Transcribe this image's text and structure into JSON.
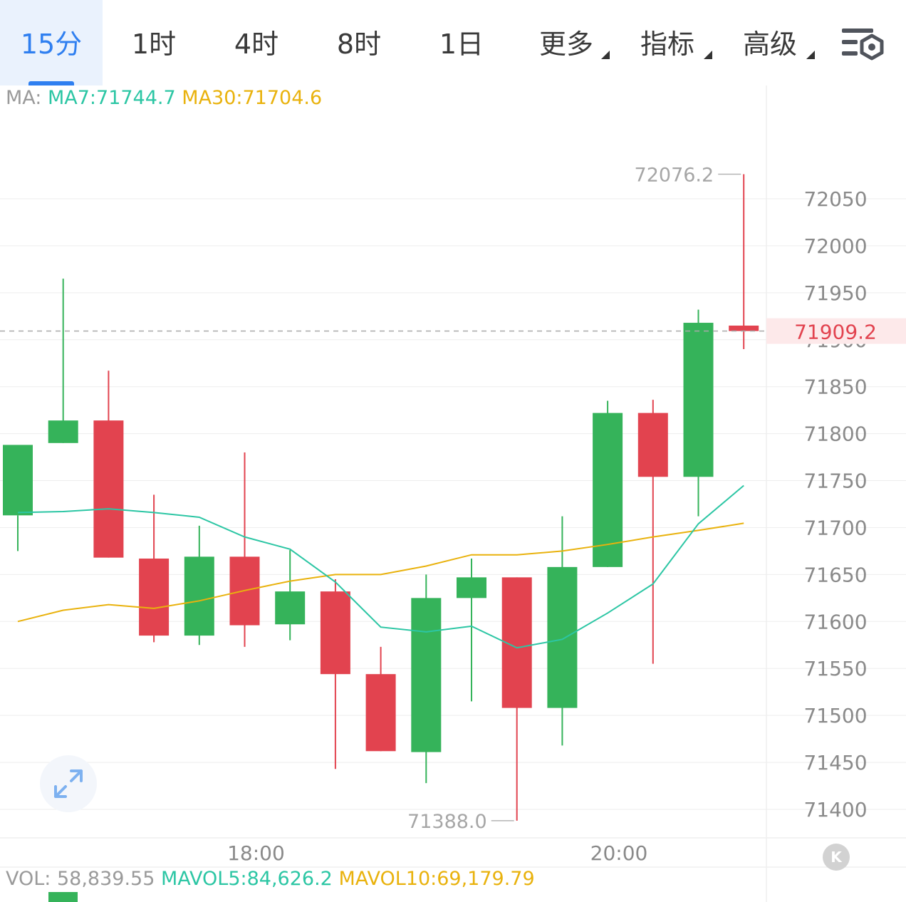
{
  "tabs": [
    {
      "label": "15分",
      "active": true
    },
    {
      "label": "1时"
    },
    {
      "label": "4时"
    },
    {
      "label": "8时"
    },
    {
      "label": "1日"
    },
    {
      "label": "更多",
      "dropdown": true
    },
    {
      "label": "指标",
      "dropdown": true
    },
    {
      "label": "高级",
      "dropdown": true
    }
  ],
  "settings_icon": "chart-settings-icon",
  "ma": {
    "prefix": "MA:",
    "ma7": "MA7:71744.7",
    "ma30": "MA30:71704.6"
  },
  "vol": {
    "prefix": "VOL:",
    "value": "58,839.55",
    "mavol5": "MAVOL5:84,626.2",
    "mavol10": "MAVOL10:69,179.79"
  },
  "expand_icon": "expand-arrows-icon",
  "kline_button": {
    "icon": "k-icon",
    "label": "K"
  },
  "colors": {
    "up": "#35b35a",
    "down": "#e2434f",
    "ma7": "#2cc6a4",
    "ma30": "#e9b20d",
    "accent": "#2f7ff0",
    "grid": "#eeeeee",
    "axis_text": "#8a8a8a"
  },
  "chart_data": {
    "type": "candlestick",
    "ylim": [
      71360,
      72110
    ],
    "y_ticks": [
      72050,
      72000,
      71950,
      71900,
      71850,
      71800,
      71750,
      71700,
      71650,
      71600,
      71550,
      71500,
      71450,
      71400
    ],
    "x_ticks": [
      "18:00",
      "20:00"
    ],
    "x_tick_index": [
      5.25,
      13.25
    ],
    "candles": [
      {
        "open": 71713,
        "high": 71713,
        "low": 71675,
        "close": 71788
      },
      {
        "open": 71790,
        "high": 71965,
        "low": 71790,
        "close": 71814
      },
      {
        "open": 71814,
        "high": 71867,
        "low": 71668,
        "close": 71668
      },
      {
        "open": 71667,
        "high": 71735,
        "low": 71578,
        "close": 71585
      },
      {
        "open": 71585,
        "high": 71702,
        "low": 71575,
        "close": 71669
      },
      {
        "open": 71669,
        "high": 71780,
        "low": 71573,
        "close": 71596
      },
      {
        "open": 71597,
        "high": 71676,
        "low": 71580,
        "close": 71632
      },
      {
        "open": 71632,
        "high": 71645,
        "low": 71443,
        "close": 71544
      },
      {
        "open": 71544,
        "high": 71573,
        "low": 71462,
        "close": 71462
      },
      {
        "open": 71461,
        "high": 71650,
        "low": 71428,
        "close": 71625
      },
      {
        "open": 71625,
        "high": 71667,
        "low": 71515,
        "close": 71647
      },
      {
        "open": 71647,
        "high": 71647,
        "low": 71388,
        "close": 71508
      },
      {
        "open": 71508,
        "high": 71712,
        "low": 71468,
        "close": 71658
      },
      {
        "open": 71658,
        "high": 71835,
        "low": 71658,
        "close": 71822
      },
      {
        "open": 71822,
        "high": 71836,
        "low": 71555,
        "close": 71754
      },
      {
        "open": 71754,
        "high": 71932,
        "low": 71712,
        "close": 71918
      },
      {
        "open": 71915,
        "high": 72076.2,
        "low": 71890,
        "close": 71909.2
      }
    ],
    "ma7": [
      71716,
      71717,
      71720,
      71716,
      71711,
      71690,
      71677,
      71642,
      71594,
      71589,
      71595,
      71572,
      71581,
      71609,
      71640,
      71704,
      71744.7
    ],
    "ma30": [
      71600,
      71612,
      71618,
      71614,
      71622,
      71633,
      71643,
      71650,
      71650,
      71659,
      71671,
      71671,
      71675,
      71682,
      71690,
      71697,
      71704.6
    ],
    "annotations": {
      "high_label": "72076.2",
      "low_label": "71388.0",
      "last_price_label": "71909.2"
    }
  }
}
